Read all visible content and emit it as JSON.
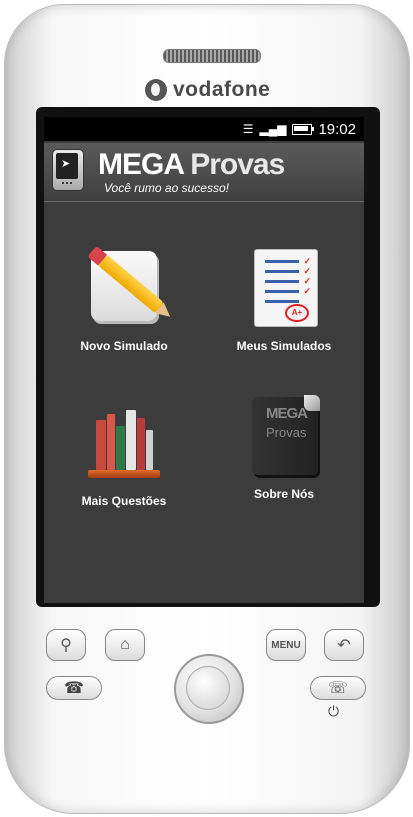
{
  "device": {
    "carrier": "vodafone"
  },
  "status_bar": {
    "time": "19:02",
    "wifi_icon": "wifi-icon",
    "signal_icon": "signal-icon",
    "battery_icon": "battery-icon",
    "battery_level": 0.9
  },
  "app": {
    "title_bold": "MEGA",
    "title_rest": "Provas",
    "subtitle": "Você rumo ao sucesso!"
  },
  "menu": {
    "items": [
      {
        "label": "Novo Simulado",
        "icon": "pencil-paper-icon"
      },
      {
        "label": "Meus Simulados",
        "icon": "checklist-icon"
      },
      {
        "label": "Mais Questões",
        "icon": "books-icon"
      },
      {
        "label": "Sobre Nós",
        "icon": "notebook-icon"
      }
    ]
  },
  "notebook_icon_text": {
    "line1": "MEGA",
    "line2": "Provas"
  },
  "grade_badge": "A+",
  "hardware_buttons": {
    "menu_label": "MENU"
  }
}
